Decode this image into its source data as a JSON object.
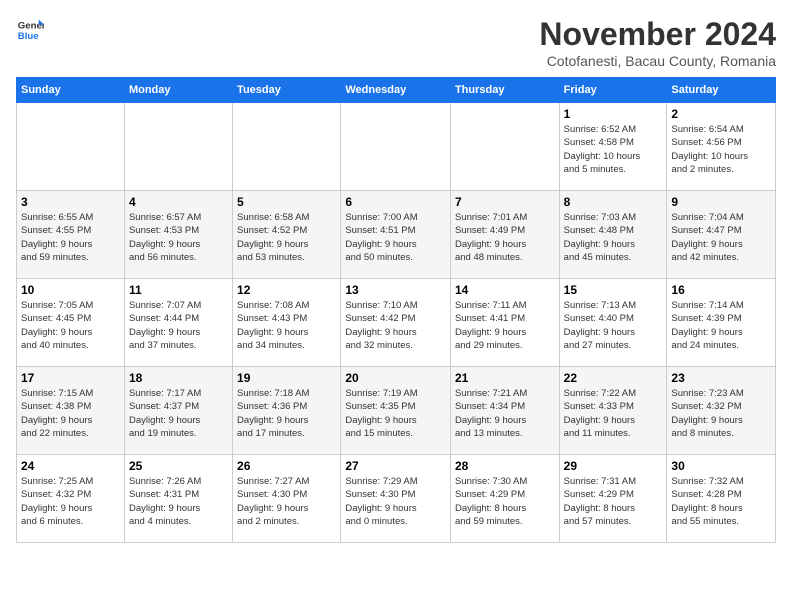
{
  "logo": {
    "line1": "General",
    "line2": "Blue"
  },
  "title": {
    "month_year": "November 2024",
    "location": "Cotofanesti, Bacau County, Romania"
  },
  "headers": [
    "Sunday",
    "Monday",
    "Tuesday",
    "Wednesday",
    "Thursday",
    "Friday",
    "Saturday"
  ],
  "weeks": [
    [
      {
        "day": "",
        "info": ""
      },
      {
        "day": "",
        "info": ""
      },
      {
        "day": "",
        "info": ""
      },
      {
        "day": "",
        "info": ""
      },
      {
        "day": "",
        "info": ""
      },
      {
        "day": "1",
        "info": "Sunrise: 6:52 AM\nSunset: 4:58 PM\nDaylight: 10 hours\nand 5 minutes."
      },
      {
        "day": "2",
        "info": "Sunrise: 6:54 AM\nSunset: 4:56 PM\nDaylight: 10 hours\nand 2 minutes."
      }
    ],
    [
      {
        "day": "3",
        "info": "Sunrise: 6:55 AM\nSunset: 4:55 PM\nDaylight: 9 hours\nand 59 minutes."
      },
      {
        "day": "4",
        "info": "Sunrise: 6:57 AM\nSunset: 4:53 PM\nDaylight: 9 hours\nand 56 minutes."
      },
      {
        "day": "5",
        "info": "Sunrise: 6:58 AM\nSunset: 4:52 PM\nDaylight: 9 hours\nand 53 minutes."
      },
      {
        "day": "6",
        "info": "Sunrise: 7:00 AM\nSunset: 4:51 PM\nDaylight: 9 hours\nand 50 minutes."
      },
      {
        "day": "7",
        "info": "Sunrise: 7:01 AM\nSunset: 4:49 PM\nDaylight: 9 hours\nand 48 minutes."
      },
      {
        "day": "8",
        "info": "Sunrise: 7:03 AM\nSunset: 4:48 PM\nDaylight: 9 hours\nand 45 minutes."
      },
      {
        "day": "9",
        "info": "Sunrise: 7:04 AM\nSunset: 4:47 PM\nDaylight: 9 hours\nand 42 minutes."
      }
    ],
    [
      {
        "day": "10",
        "info": "Sunrise: 7:05 AM\nSunset: 4:45 PM\nDaylight: 9 hours\nand 40 minutes."
      },
      {
        "day": "11",
        "info": "Sunrise: 7:07 AM\nSunset: 4:44 PM\nDaylight: 9 hours\nand 37 minutes."
      },
      {
        "day": "12",
        "info": "Sunrise: 7:08 AM\nSunset: 4:43 PM\nDaylight: 9 hours\nand 34 minutes."
      },
      {
        "day": "13",
        "info": "Sunrise: 7:10 AM\nSunset: 4:42 PM\nDaylight: 9 hours\nand 32 minutes."
      },
      {
        "day": "14",
        "info": "Sunrise: 7:11 AM\nSunset: 4:41 PM\nDaylight: 9 hours\nand 29 minutes."
      },
      {
        "day": "15",
        "info": "Sunrise: 7:13 AM\nSunset: 4:40 PM\nDaylight: 9 hours\nand 27 minutes."
      },
      {
        "day": "16",
        "info": "Sunrise: 7:14 AM\nSunset: 4:39 PM\nDaylight: 9 hours\nand 24 minutes."
      }
    ],
    [
      {
        "day": "17",
        "info": "Sunrise: 7:15 AM\nSunset: 4:38 PM\nDaylight: 9 hours\nand 22 minutes."
      },
      {
        "day": "18",
        "info": "Sunrise: 7:17 AM\nSunset: 4:37 PM\nDaylight: 9 hours\nand 19 minutes."
      },
      {
        "day": "19",
        "info": "Sunrise: 7:18 AM\nSunset: 4:36 PM\nDaylight: 9 hours\nand 17 minutes."
      },
      {
        "day": "20",
        "info": "Sunrise: 7:19 AM\nSunset: 4:35 PM\nDaylight: 9 hours\nand 15 minutes."
      },
      {
        "day": "21",
        "info": "Sunrise: 7:21 AM\nSunset: 4:34 PM\nDaylight: 9 hours\nand 13 minutes."
      },
      {
        "day": "22",
        "info": "Sunrise: 7:22 AM\nSunset: 4:33 PM\nDaylight: 9 hours\nand 11 minutes."
      },
      {
        "day": "23",
        "info": "Sunrise: 7:23 AM\nSunset: 4:32 PM\nDaylight: 9 hours\nand 8 minutes."
      }
    ],
    [
      {
        "day": "24",
        "info": "Sunrise: 7:25 AM\nSunset: 4:32 PM\nDaylight: 9 hours\nand 6 minutes."
      },
      {
        "day": "25",
        "info": "Sunrise: 7:26 AM\nSunset: 4:31 PM\nDaylight: 9 hours\nand 4 minutes."
      },
      {
        "day": "26",
        "info": "Sunrise: 7:27 AM\nSunset: 4:30 PM\nDaylight: 9 hours\nand 2 minutes."
      },
      {
        "day": "27",
        "info": "Sunrise: 7:29 AM\nSunset: 4:30 PM\nDaylight: 9 hours\nand 0 minutes."
      },
      {
        "day": "28",
        "info": "Sunrise: 7:30 AM\nSunset: 4:29 PM\nDaylight: 8 hours\nand 59 minutes."
      },
      {
        "day": "29",
        "info": "Sunrise: 7:31 AM\nSunset: 4:29 PM\nDaylight: 8 hours\nand 57 minutes."
      },
      {
        "day": "30",
        "info": "Sunrise: 7:32 AM\nSunset: 4:28 PM\nDaylight: 8 hours\nand 55 minutes."
      }
    ]
  ]
}
